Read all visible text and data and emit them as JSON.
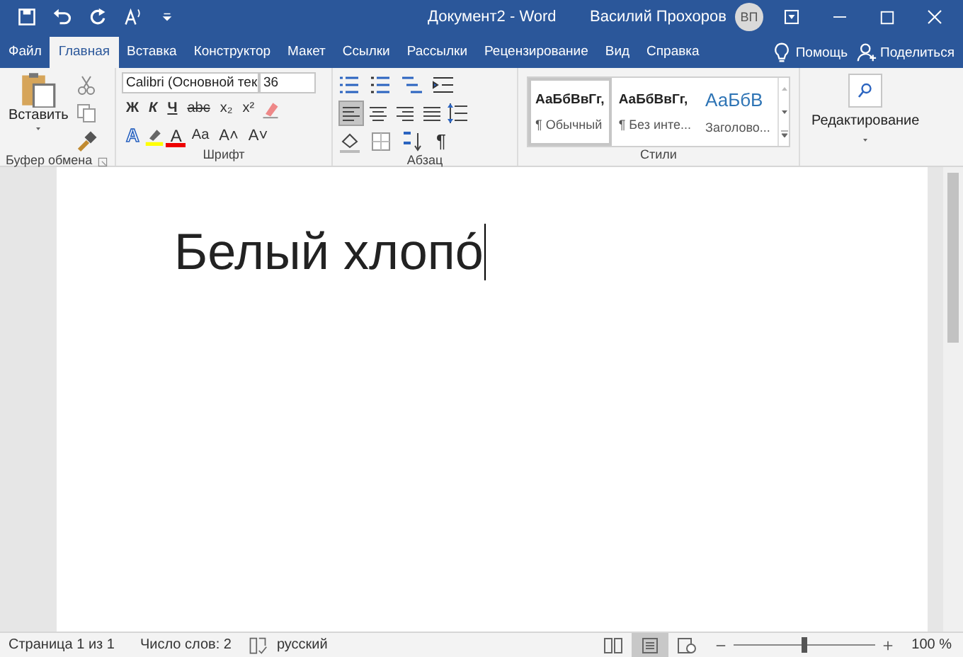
{
  "window": {
    "title": "Документ2 - Word",
    "user": "Василий Прохоров",
    "avatar": "ВП"
  },
  "tabs": [
    {
      "label": "Файл",
      "selected": false
    },
    {
      "label": "Главная",
      "selected": true
    },
    {
      "label": "Вставка",
      "selected": false
    },
    {
      "label": "Конструктор",
      "selected": false
    },
    {
      "label": "Макет",
      "selected": false
    },
    {
      "label": "Ссылки",
      "selected": false
    },
    {
      "label": "Рассылки",
      "selected": false
    },
    {
      "label": "Рецензирование",
      "selected": false
    },
    {
      "label": "Вид",
      "selected": false
    },
    {
      "label": "Справка",
      "selected": false
    }
  ],
  "tell_me": "Помощь",
  "share": "Поделиться",
  "clipboard": {
    "paste": "Вставить",
    "group": "Буфер обмена"
  },
  "font": {
    "name": "Calibri (Основной тек",
    "size": "36",
    "group": "Шрифт",
    "format_buttons": [
      {
        "label": "Ж",
        "kind": "bold"
      },
      {
        "label": "К",
        "kind": "italic"
      },
      {
        "label": "Ч",
        "kind": "underline"
      },
      {
        "label": "abc",
        "kind": "strike"
      },
      {
        "label": "x₂",
        "kind": "plain"
      },
      {
        "label": "x²",
        "kind": "plain"
      }
    ],
    "effect_buttons": [
      {
        "label": "A",
        "kind": "effects"
      },
      {
        "label": "A",
        "kind": "color"
      },
      {
        "label": "Aa",
        "kind": "case"
      },
      {
        "label": "A˄",
        "kind": "grow"
      },
      {
        "label": "A˅",
        "kind": "shrink"
      }
    ]
  },
  "paragraph": {
    "group": "Абзац",
    "alignments": [
      {
        "selected": true
      },
      {
        "selected": false
      },
      {
        "selected": false
      },
      {
        "selected": false
      }
    ],
    "marks": "¶"
  },
  "styles": {
    "group": "Стили",
    "items": [
      {
        "preview": "АаБбВвГг,",
        "name": "¶ Обычный",
        "kind": "normal",
        "selected": true
      },
      {
        "preview": "АаБбВвГг,",
        "name": "¶ Без инте...",
        "kind": "normal",
        "selected": false
      },
      {
        "preview": "АаБбВ",
        "name": "Заголово...",
        "kind": "heading",
        "selected": false
      }
    ]
  },
  "editing": {
    "label": "Редактирование"
  },
  "document": {
    "text": "Белый хлопо́"
  },
  "status_bar": {
    "page": "Страница 1 из 1",
    "words": "Число слов: 2",
    "language": "русский",
    "views": [
      {
        "kind": "read",
        "selected": false
      },
      {
        "kind": "print",
        "selected": true
      },
      {
        "kind": "web",
        "selected": false
      }
    ],
    "zoom": {
      "level": 0.5,
      "reading": "100 %"
    }
  }
}
